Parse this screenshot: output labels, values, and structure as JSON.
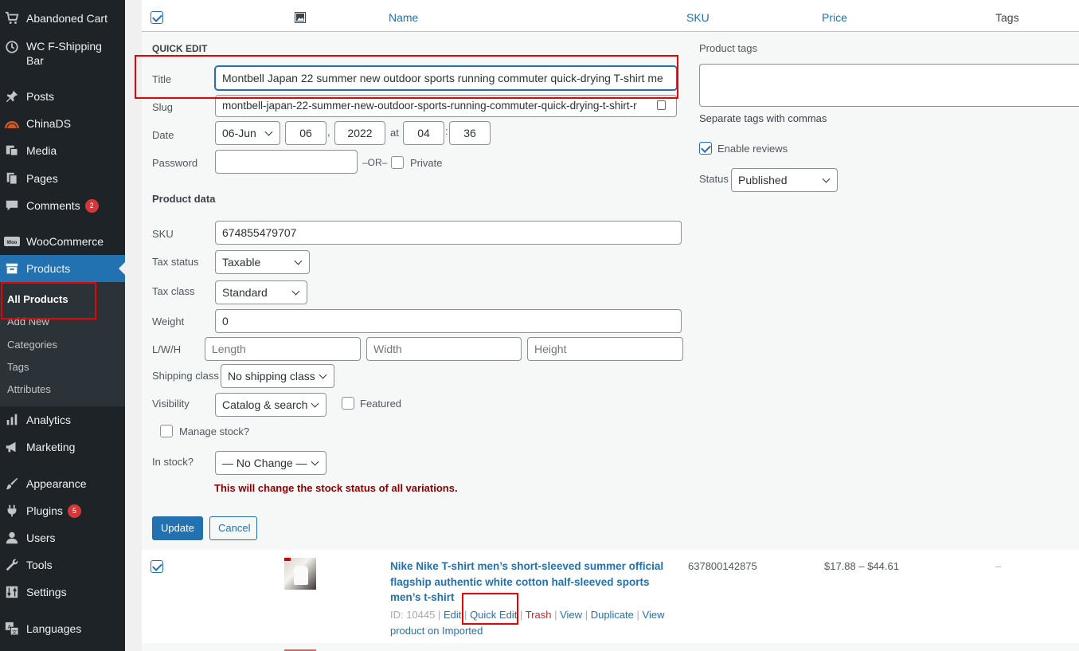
{
  "sidebar": {
    "items": [
      {
        "label": "Abandoned Cart",
        "icon": "cart-icon"
      },
      {
        "label": "WC F-Shipping",
        "label2": "Bar",
        "icon": "clock-icon"
      },
      {
        "label": "Posts",
        "icon": "pin-icon"
      },
      {
        "label": "ChinaDS",
        "icon": "chinads-icon"
      },
      {
        "label": "Media",
        "icon": "media-icon"
      },
      {
        "label": "Pages",
        "icon": "pages-icon"
      },
      {
        "label": "Comments",
        "icon": "comment-icon",
        "badge": "2"
      },
      {
        "label": "WooCommerce",
        "icon": "woo-icon"
      },
      {
        "label": "Products",
        "icon": "archive-icon"
      },
      {
        "label": "Analytics",
        "icon": "bar-chart-icon"
      },
      {
        "label": "Marketing",
        "icon": "megaphone-icon"
      },
      {
        "label": "Appearance",
        "icon": "brush-icon"
      },
      {
        "label": "Plugins",
        "icon": "plug-icon",
        "badge": "5"
      },
      {
        "label": "Users",
        "icon": "user-icon"
      },
      {
        "label": "Tools",
        "icon": "wrench-icon"
      },
      {
        "label": "Settings",
        "icon": "settings-icon"
      },
      {
        "label": "Languages",
        "icon": "translate-icon"
      }
    ],
    "submenu": [
      "All Products",
      "Add New",
      "Categories",
      "Tags",
      "Attributes"
    ]
  },
  "table": {
    "headers": {
      "name": "Name",
      "sku": "SKU",
      "price": "Price",
      "tags": "Tags"
    }
  },
  "quick_edit": {
    "heading": "QUICK EDIT",
    "title_label": "Title",
    "title_value": "Montbell Japan 22 summer new outdoor sports running commuter quick-drying T-shirt me",
    "slug_label": "Slug",
    "slug_value": "montbell-japan-22-summer-new-outdoor-sports-running-commuter-quick-drying-t-shirt-r",
    "date_label": "Date",
    "date_month": "06-Jun",
    "date_day": "06",
    "date_comma": ",",
    "date_year": "2022",
    "date_at": "at",
    "date_hour": "04",
    "date_colon": ":",
    "date_minute": "36",
    "password_label": "Password",
    "or_text": "–OR–",
    "private_label": "Private",
    "product_data_heading": "Product data",
    "sku_label": "SKU",
    "sku_value": "674855479707",
    "tax_status_label": "Tax status",
    "tax_status_value": "Taxable",
    "tax_class_label": "Tax class",
    "tax_class_value": "Standard",
    "weight_label": "Weight",
    "weight_value": "0",
    "lwh_label": "L/W/H",
    "length_placeholder": "Length",
    "width_placeholder": "Width",
    "height_placeholder": "Height",
    "shipping_class_label": "Shipping class",
    "shipping_class_value": "No shipping class",
    "visibility_label": "Visibility",
    "visibility_value": "Catalog & search",
    "featured_label": "Featured",
    "manage_stock_label": "Manage stock?",
    "in_stock_label": "In stock?",
    "in_stock_value": "— No Change —",
    "stock_warning": "This will change the stock status of all variations.",
    "update_label": "Update",
    "cancel_label": "Cancel",
    "product_tags_label": "Product tags",
    "tags_hint": "Separate tags with commas",
    "enable_reviews_label": "Enable reviews",
    "status_label": "Status",
    "status_value": "Published"
  },
  "product_row": {
    "name_line1": "Nike Nike T-shirt men’s short-sleeved summer official",
    "name_line2": "flagship authentic white cotton half-sleeved sports",
    "name_line3": "men’s t-shirt",
    "id_text": "ID: 10445",
    "edit": "Edit",
    "quick_edit": "Quick Edit",
    "trash": "Trash",
    "view": "View",
    "duplicate": "Duplicate",
    "view_imported_1": "View",
    "view_imported_2": "product on Imported",
    "sku": "637800142875",
    "price": "$17.88 – $44.61",
    "tags": "–"
  },
  "colors": {
    "sidebar": "#1d2327",
    "accent": "#2271b1",
    "highlight": "#e00000",
    "trash": "#b32d2e",
    "warning": "#8a0000"
  }
}
